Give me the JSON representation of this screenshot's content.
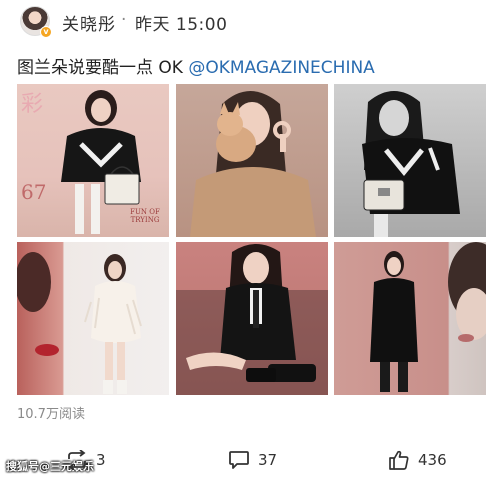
{
  "post": {
    "username": "关晓彤",
    "separator": "·",
    "time": "昨天 15:00",
    "text_main": "图兰朵说要酷一点 OK ",
    "mention": "@OKMAGAZINECHINA",
    "reads": "10.7万阅读"
  },
  "magazine": {
    "title": "彩",
    "issue": "67",
    "note": "FUN OF TRYING"
  },
  "actions": {
    "repost_count": "3",
    "comment_count": "37",
    "like_count": "436"
  },
  "watermark": "搜狐号@三元娱乐",
  "icons": {
    "avatar": "avatar",
    "verified": "verified-badge-icon",
    "repost": "repost-icon",
    "comment": "comment-icon",
    "like": "thumbs-up-icon"
  },
  "colors": {
    "mention": "#2a6cb0",
    "verified": "#f5a623",
    "muted": "#8a8a8a"
  }
}
